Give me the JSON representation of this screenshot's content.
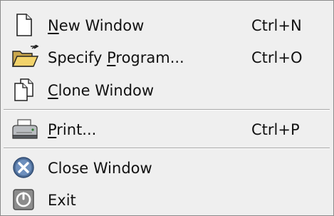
{
  "menu": {
    "items": [
      {
        "label_pre": "",
        "mnemonic": "N",
        "label_post": "ew Window",
        "shortcut": "Ctrl+N",
        "icon": "new-window-icon"
      },
      {
        "label_pre": "Specify ",
        "mnemonic": "P",
        "label_post": "rogram...",
        "shortcut": "Ctrl+O",
        "icon": "folder-open-icon"
      },
      {
        "label_pre": "",
        "mnemonic": "C",
        "label_post": "lone Window",
        "shortcut": "",
        "icon": "clone-window-icon"
      },
      {
        "label_pre": "",
        "mnemonic": "P",
        "label_post": "rint...",
        "shortcut": "Ctrl+P",
        "icon": "printer-icon"
      },
      {
        "label_pre": "Close Window",
        "mnemonic": "",
        "label_post": "",
        "shortcut": "",
        "icon": "close-window-icon"
      },
      {
        "label_pre": "Exit",
        "mnemonic": "",
        "label_post": "",
        "shortcut": "",
        "icon": "exit-icon"
      }
    ]
  }
}
